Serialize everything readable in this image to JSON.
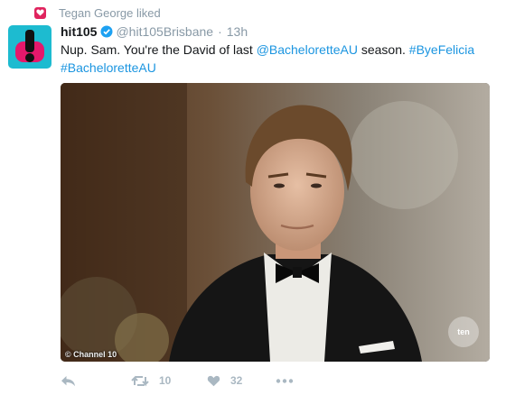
{
  "notification": {
    "icon": "heart-icon",
    "text": "Tegan George liked",
    "accent": "#e0245e"
  },
  "tweet": {
    "author_name": "hit105",
    "verified_icon": "verified-badge-icon",
    "handle": "@hit105Brisbane",
    "separator": "·",
    "time": "13h",
    "text_prefix": "Nup. Sam. You're the David of last ",
    "mention": "@BacheloretteAU",
    "text_middle": " season. ",
    "hashtag1": "#ByeFelicia",
    "hashtag2": "#BacheloretteAU",
    "link_color": "#1b95e0"
  },
  "media": {
    "watermark_left": "© Channel 10",
    "watermark_right": "ten"
  },
  "actions": {
    "reply_icon": "reply-icon",
    "retweet_icon": "retweet-icon",
    "retweet_count": "10",
    "like_icon": "heart-icon",
    "like_count": "32",
    "more_icon": "more-dots-icon"
  }
}
